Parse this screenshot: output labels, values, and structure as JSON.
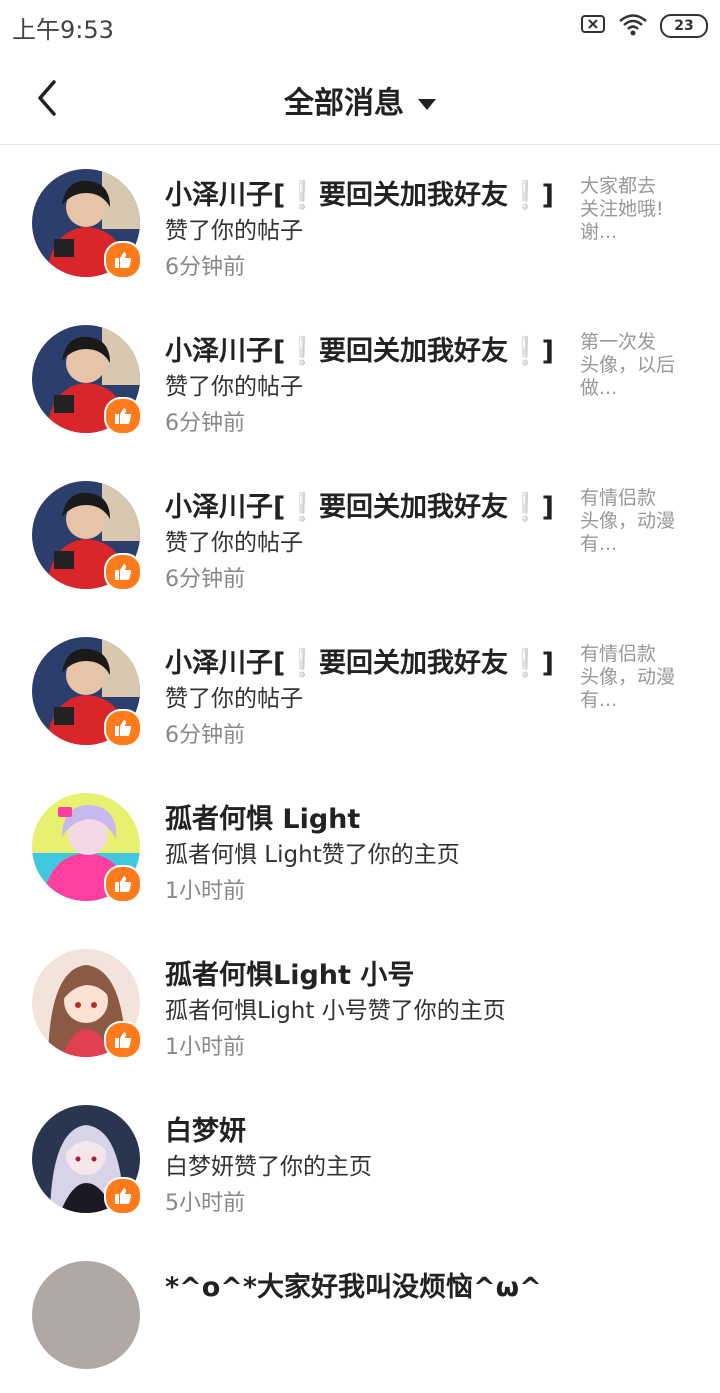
{
  "status": {
    "time": "上午9:53",
    "battery": "23"
  },
  "header": {
    "title": "全部消息"
  },
  "items": [
    {
      "name": "小泽川子[❕要回关加我好友❕]",
      "action": "赞了你的帖子",
      "time": "6分钟前",
      "preview": [
        "大家都去",
        "关注她哦!",
        "谢..."
      ]
    },
    {
      "name": "小泽川子[❕要回关加我好友❕]",
      "action": "赞了你的帖子",
      "time": "6分钟前",
      "preview": [
        "第一次发",
        "头像，以后",
        "做..."
      ]
    },
    {
      "name": "小泽川子[❕要回关加我好友❕]",
      "action": "赞了你的帖子",
      "time": "6分钟前",
      "preview": [
        "有情侣款",
        "头像，动漫",
        "有..."
      ]
    },
    {
      "name": "小泽川子[❕要回关加我好友❕]",
      "action": "赞了你的帖子",
      "time": "6分钟前",
      "preview": [
        "有情侣款",
        "头像，动漫",
        "有..."
      ]
    },
    {
      "name": "孤者何惧 Light",
      "action": "孤者何惧 Light赞了你的主页",
      "time": "1小时前",
      "preview": []
    },
    {
      "name": "孤者何惧Light 小号",
      "action": "孤者何惧Light 小号赞了你的主页",
      "time": "1小时前",
      "preview": []
    },
    {
      "name": "白梦妍",
      "action": "白梦妍赞了你的主页",
      "time": "5小时前",
      "preview": []
    },
    {
      "name": "*^o^*大家好我叫没烦恼^ω^",
      "action": "",
      "time": "",
      "preview": []
    }
  ],
  "colors": {
    "like_badge": "#ff7a1a",
    "divider": "#e6e6e6"
  },
  "icons": [
    "back-icon",
    "dropdown-caret-icon",
    "sim-off-icon",
    "wifi-icon",
    "battery-icon",
    "thumbs-up-icon"
  ]
}
